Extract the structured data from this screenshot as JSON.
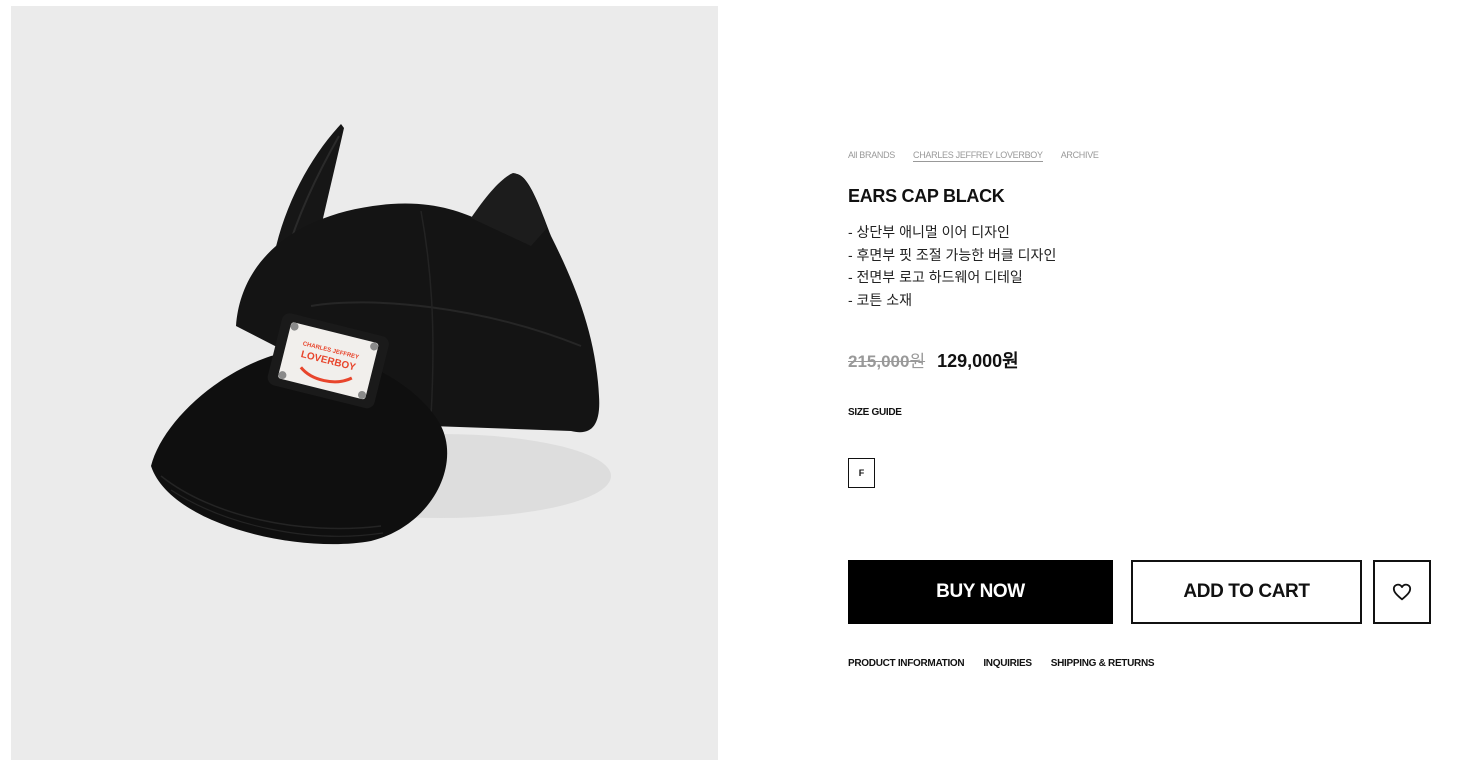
{
  "breadcrumb": {
    "items": [
      "All BRANDS",
      "CHARLES JEFFREY LOVERBOY",
      "ARCHIVE"
    ]
  },
  "product": {
    "title": "EARS CAP BLACK",
    "description": [
      "- 상단부 애니멀 이어 디자인",
      "- 후면부 핏 조절 가능한 버클 디자인",
      "- 전면부 로고 하드웨어 디테일",
      "- 코튼 소재"
    ],
    "price_original": "215,000",
    "price_original_unit": "원",
    "price_sale": "129,000원",
    "image_patch_text_1": "CHARLES JEFFREY",
    "image_patch_text_2": "LOVERBOY"
  },
  "size": {
    "guide_label": "SIZE GUIDE",
    "options": [
      "F"
    ]
  },
  "actions": {
    "buy_label": "BUY NOW",
    "cart_label": "ADD TO CART",
    "wishlist_icon": "heart-icon"
  },
  "tabs": [
    "PRODUCT INFORMATION",
    "INQUIRIES",
    "SHIPPING & RETURNS"
  ],
  "colors": {
    "image_bg": "#ebebeb",
    "primary": "#000000",
    "muted": "#999999",
    "patch_red": "#e8452c"
  }
}
